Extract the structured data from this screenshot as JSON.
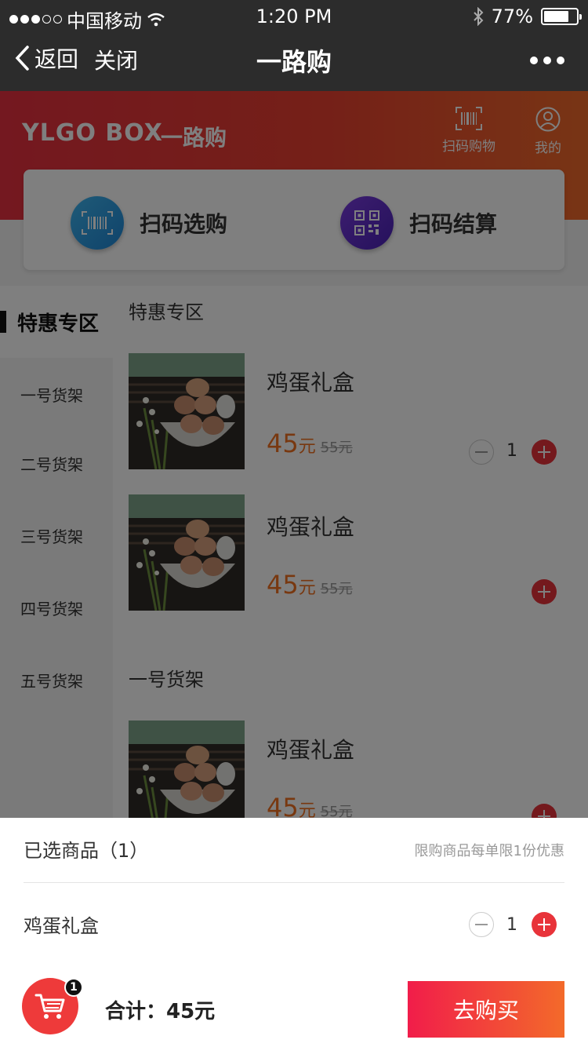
{
  "status_bar": {
    "carrier": "中国移动",
    "time": "1:20 PM",
    "battery": "77%",
    "battery_level": 0.77
  },
  "nav": {
    "back_label": "返回",
    "close_label": "关闭",
    "title": "一路购"
  },
  "header": {
    "brand": "YLGO BOX",
    "brand_sub": "一路购",
    "scan_shop_label": "扫码购物",
    "mine_label": "我的"
  },
  "actions": {
    "scan_select": "扫码选购",
    "scan_checkout": "扫码结算"
  },
  "sidebar": {
    "active": "特惠专区",
    "items": [
      "一号货架",
      "二号货架",
      "三号货架",
      "四号货架",
      "五号货架"
    ]
  },
  "sections": [
    {
      "title": "特惠专区",
      "products": [
        {
          "name": "鸡蛋礼盒",
          "price": "45",
          "unit": "元",
          "original_price": "55元",
          "quantity": "1"
        },
        {
          "name": "鸡蛋礼盒",
          "price": "45",
          "unit": "元",
          "original_price": "55元"
        }
      ]
    },
    {
      "title": "一号货架",
      "products": [
        {
          "name": "鸡蛋礼盒",
          "price": "45",
          "unit": "元",
          "original_price": "55元"
        }
      ]
    }
  ],
  "cart_sheet": {
    "title": "已选商品（1）",
    "note": "限购商品每单限1份优惠",
    "item_name": "鸡蛋礼盒",
    "item_quantity": "1",
    "badge_count": "1",
    "total": "合计：45元",
    "buy_label": "去购买"
  },
  "colors": {
    "accent": "#e8333a",
    "price": "#f07020",
    "topbar": "#2c2c2c"
  }
}
